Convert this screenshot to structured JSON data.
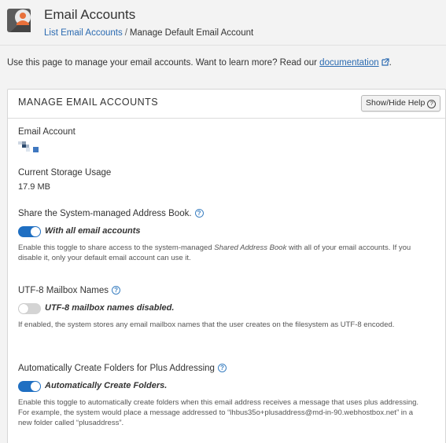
{
  "header": {
    "title": "Email Accounts",
    "breadcrumb": {
      "link": "List Email Accounts",
      "separator": "/",
      "current": "Manage Default Email Account"
    }
  },
  "intro": {
    "text": "Use this page to manage your email accounts. Want to learn more? Read our ",
    "link": "documentation",
    "suffix": "."
  },
  "card": {
    "title": "MANAGE EMAIL ACCOUNTS",
    "help_button": "Show/Hide Help",
    "email_account": {
      "label": "Email Account"
    },
    "storage": {
      "label": "Current Storage Usage",
      "value": "17.9 MB"
    },
    "address_book": {
      "label": "Share the System-managed Address Book.",
      "toggle_on": true,
      "toggle_label": "With all email accounts",
      "desc_prefix": "Enable this toggle to share access to the system-managed ",
      "desc_italic": "Shared Address Book",
      "desc_suffix": " with all of your email accounts. If you disable it, only your default email account can use it."
    },
    "utf8": {
      "label": "UTF-8 Mailbox Names",
      "toggle_on": false,
      "toggle_label": "UTF-8 mailbox names disabled.",
      "desc": "If enabled, the system stores any email mailbox names that the user creates on the filesystem as UTF-8 encoded."
    },
    "plus_addressing": {
      "label": "Automatically Create Folders for Plus Addressing",
      "toggle_on": true,
      "toggle_label": "Automatically Create Folders.",
      "desc": "Enable this toggle to automatically create folders when this email address receives a message that uses plus addressing. For example, the system would place a message addressed to “lhbus35o+plusaddress@md-in-90.webhostbox.net” in a new folder called “plusaddress”."
    }
  },
  "colors": {
    "accent": "#1f6fc2",
    "link": "#2a6ab1",
    "toggle_off": "#d4d4d4"
  }
}
